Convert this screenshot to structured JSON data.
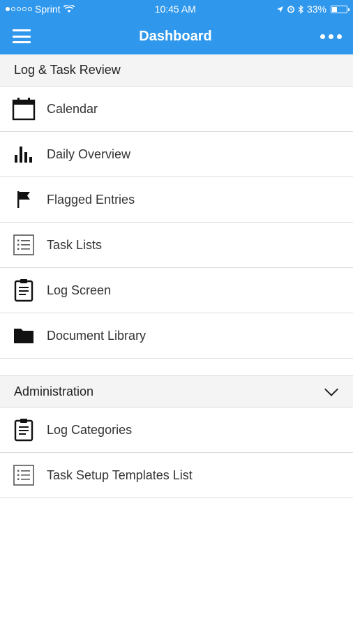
{
  "status_bar": {
    "carrier": "Sprint",
    "time": "10:45 AM",
    "battery": "33%",
    "battery_level": 0.33
  },
  "header": {
    "title": "Dashboard"
  },
  "log_task_review": {
    "title": "Log & Task Review",
    "items": [
      {
        "label": "Calendar",
        "icon": "calendar-icon"
      },
      {
        "label": "Daily Overview",
        "icon": "bar-chart-icon"
      },
      {
        "label": "Flagged Entries",
        "icon": "flag-icon"
      },
      {
        "label": "Task Lists",
        "icon": "list-icon"
      },
      {
        "label": "Log Screen",
        "icon": "clipboard-icon"
      },
      {
        "label": "Document Library",
        "icon": "folder-icon"
      }
    ]
  },
  "administration": {
    "title": "Administration",
    "items": [
      {
        "label": "Log Categories",
        "icon": "clipboard-icon"
      },
      {
        "label": "Task Setup Templates List",
        "icon": "list-icon"
      }
    ]
  },
  "colors": {
    "brand": "#2f98ec",
    "section_bg": "#f4f4f4",
    "divider": "#dcdcdc"
  }
}
